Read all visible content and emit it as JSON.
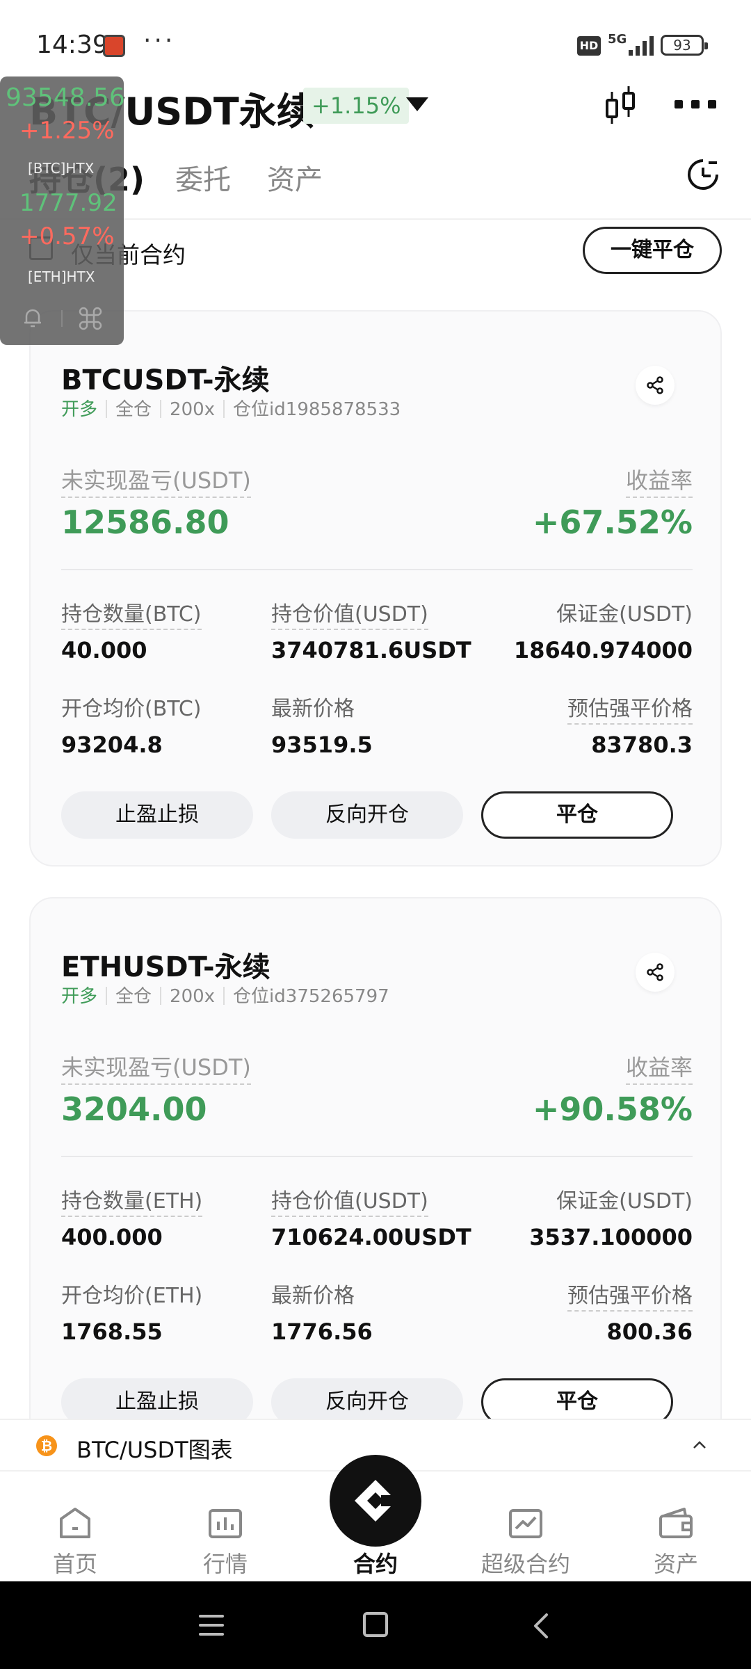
{
  "status_bar": {
    "time": "14:39",
    "dots": "···",
    "hd": "HD",
    "network": "5G",
    "battery": "93"
  },
  "header": {
    "pair_title": "BTC/USDT永续",
    "change": "+1.15%"
  },
  "tabs": [
    {
      "label": "持仓(2)",
      "active": true
    },
    {
      "label": "委托",
      "active": false
    },
    {
      "label": "资产",
      "active": false
    }
  ],
  "filter": {
    "checkbox_label": "仅当前合约",
    "close_all_label": "一键平仓"
  },
  "floating_widget": {
    "btc_price": "93548.56",
    "btc_change": "+1.25%",
    "btc_symbol": "[BTC]HTX",
    "eth_price": "1777.92",
    "eth_change": "+0.57%",
    "eth_symbol": "[ETH]HTX"
  },
  "positions": [
    {
      "symbol": "BTCUSDT-永续",
      "side": "开多",
      "margin_mode": "全仓",
      "leverage": "200x",
      "position_id": "仓位id1985878533",
      "pnl_label": "未实现盈亏(USDT)",
      "pnl_value": "12586.80",
      "roe_label": "收益率",
      "roe_value": "+67.52%",
      "qty_label": "持仓数量(BTC)",
      "qty_value": "40.000",
      "notional_label": "持仓价值(USDT)",
      "notional_value": "3740781.6USDT",
      "margin_label": "保证金(USDT)",
      "margin_value": "18640.974000",
      "entry_label": "开仓均价(BTC)",
      "entry_value": "93204.8",
      "last_label": "最新价格",
      "last_value": "93519.5",
      "liq_label": "预估强平价格",
      "liq_value": "83780.3",
      "tpsl_label": "止盈止损",
      "reverse_label": "反向开仓",
      "close_label": "平仓"
    },
    {
      "symbol": "ETHUSDT-永续",
      "side": "开多",
      "margin_mode": "全仓",
      "leverage": "200x",
      "position_id": "仓位id375265797",
      "pnl_label": "未实现盈亏(USDT)",
      "pnl_value": "3204.00",
      "roe_label": "收益率",
      "roe_value": "+90.58%",
      "qty_label": "持仓数量(ETH)",
      "qty_value": "400.000",
      "notional_label": "持仓价值(USDT)",
      "notional_value": "710624.00USDT",
      "margin_label": "保证金(USDT)",
      "margin_value": "3537.100000",
      "entry_label": "开仓均价(ETH)",
      "entry_value": "1768.55",
      "last_label": "最新价格",
      "last_value": "1776.56",
      "liq_label": "预估强平价格",
      "liq_value": "800.36",
      "tpsl_label": "止盈止损",
      "reverse_label": "反向开仓",
      "close_label": "平仓"
    }
  ],
  "chart_bar": {
    "coin_glyph": "₿",
    "label": "BTC/USDT图表"
  },
  "bottom_nav": [
    {
      "label": "首页",
      "icon": "home-icon"
    },
    {
      "label": "行情",
      "icon": "market-icon"
    },
    {
      "label": "合约",
      "icon": "contract-icon",
      "active": true
    },
    {
      "label": "超级合约",
      "icon": "super-contract-icon"
    },
    {
      "label": "资产",
      "icon": "wallet-icon"
    }
  ],
  "colors": {
    "profit_green": "#3f9b58",
    "loss_red": "#ff6a5e",
    "accent_dark": "#111111"
  }
}
